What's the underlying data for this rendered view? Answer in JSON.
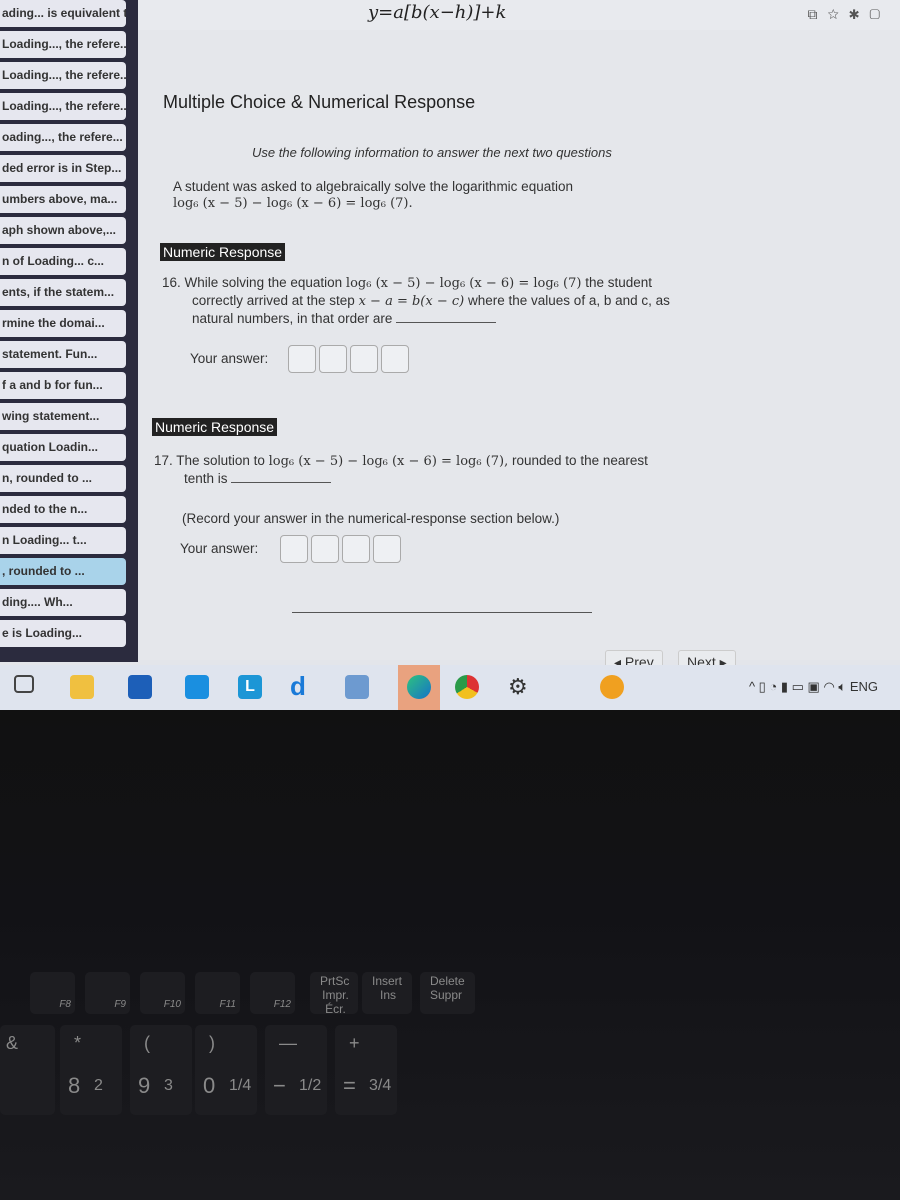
{
  "sidebar": {
    "items": [
      "ading... is equivalent to",
      "Loading..., the refere...",
      "Loading..., the refere...",
      "Loading..., the refere...",
      "oading..., the refere...",
      "ded error is in Step...",
      "umbers above, ma...",
      "aph shown above,...",
      "n of Loading... c...",
      "ents, if the statem...",
      "rmine the domai...",
      "statement. Fun...",
      "f a and b for fun...",
      "wing statement...",
      "quation Loadin...",
      "n, rounded to ...",
      "nded to the n...",
      "n Loading... t...",
      ", rounded to ...",
      "ding.... Wh...",
      "e is Loading..."
    ],
    "active_index": 18
  },
  "top_formula": "y=a[b(x−h)]+k",
  "page_title": "Multiple Choice & Numerical Response",
  "info": "Use the following information to answer the next two questions",
  "intro": {
    "text": "A student was asked to algebraically solve the logarithmic equation",
    "equation": "log₆ (x − 5) − log₆ (x − 6) = log₆ (7)."
  },
  "q16": {
    "badge": "Numeric Response",
    "number": "16.",
    "text1": "While solving the equation",
    "equation": "log₆ (x − 5) − log₆ (x − 6) = log₆ (7)",
    "text2": "the student",
    "text3": "correctly arrived at the step",
    "step": "x − a = b(x − c)",
    "text4": "where the values of a, b and c, as",
    "text5": "natural numbers, in that order are",
    "answer_label": "Your answer:"
  },
  "q17": {
    "badge": "Numeric Response",
    "number": "17.",
    "text1": "The solution to",
    "equation": "log₆ (x − 5) − log₆ (x − 6) = log₆ (7),",
    "text2": "rounded to the nearest",
    "text3": "tenth is",
    "note": "(Record your answer in the numerical-response section below.)",
    "answer_label": "Your answer:"
  },
  "nav": {
    "prev": "◂ Prev",
    "next": "Next ▸"
  },
  "taskbar": {
    "language": "ENG",
    "apps": [
      "task-view",
      "file-explorer",
      "store",
      "mail",
      "l-app",
      "d-app",
      "notepad",
      "edge",
      "chrome",
      "settings"
    ]
  },
  "keyboard": {
    "fkeys": [
      "F8",
      "F9",
      "F10",
      "F11",
      "F12"
    ],
    "prtsc": "PrtSc",
    "prtsc2": "Impr. Écr.",
    "insert": "Insert",
    "ins": "Ins",
    "delete": "Delete",
    "suppr": "Suppr",
    "num": [
      "8",
      "2",
      "9",
      "3",
      "0",
      "1/4",
      "−",
      "1/2",
      "=",
      "3/4"
    ],
    "sym": [
      "&",
      "*",
      "(",
      ")",
      "—",
      "+"
    ]
  }
}
